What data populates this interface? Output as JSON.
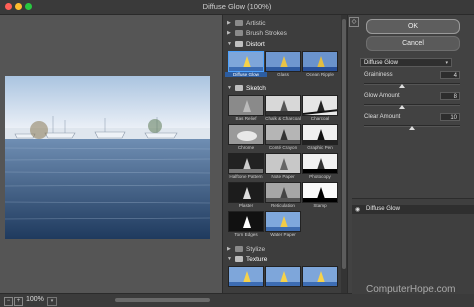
{
  "window": {
    "title": "Diffuse Glow (100%)"
  },
  "statusbar": {
    "zoom_out": "−",
    "zoom_in": "+",
    "zoom": "100%",
    "zoom_menu": "▾"
  },
  "gallery": {
    "categories": [
      {
        "label": "Artistic",
        "open": false
      },
      {
        "label": "Brush Strokes",
        "open": false
      },
      {
        "label": "Distort",
        "open": true
      },
      {
        "label": "Sketch",
        "open": true
      },
      {
        "label": "Stylize",
        "open": false
      },
      {
        "label": "Texture",
        "open": true
      }
    ],
    "distort_filters": [
      "Diffuse Glow",
      "Glass",
      "Ocean Ripple"
    ],
    "sketch_filters": [
      "Bas Relief",
      "Chalk & Charcoal",
      "Charcoal",
      "Chrome",
      "Conté Crayon",
      "Graphic Pen",
      "Halftone Pattern",
      "Note Paper",
      "Photocopy",
      "Plaster",
      "Reticulation",
      "Stamp",
      "Torn Edges",
      "Water Paper"
    ]
  },
  "controls": {
    "ok_label": "OK",
    "cancel_label": "Cancel",
    "collapse_icon": "◇",
    "filter_select": "Diffuse Glow",
    "params": [
      {
        "label": "Graininess",
        "value": "4",
        "fraction": 0.4
      },
      {
        "label": "Glow Amount",
        "value": "8",
        "fraction": 0.4
      },
      {
        "label": "Clear Amount",
        "value": "10",
        "fraction": 0.5
      }
    ]
  },
  "layers": {
    "items": [
      {
        "name": "Diffuse Glow",
        "visible": true
      }
    ]
  },
  "watermark": "ComputerHope.com",
  "colors": {
    "selected": "#2d5da0",
    "selection_border": "#4da3ff",
    "panel": "#424242"
  }
}
